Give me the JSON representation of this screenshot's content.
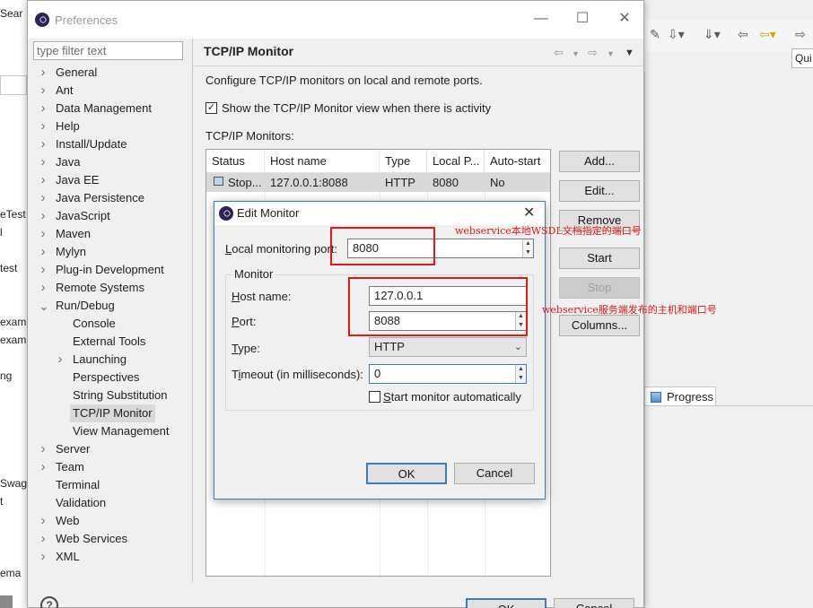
{
  "background": {
    "left_fragments": [
      "Sear",
      "eTest",
      "l",
      "test",
      "exam",
      "exam",
      "ng",
      "Swag",
      "t",
      "ema"
    ],
    "quick_access": "Qui",
    "progress_tab": "Progress"
  },
  "preferences": {
    "title": "Preferences",
    "filter_placeholder": "type filter text",
    "tree": [
      {
        "label": "General",
        "expandable": true
      },
      {
        "label": "Ant",
        "expandable": true
      },
      {
        "label": "Data Management",
        "expandable": true
      },
      {
        "label": "Help",
        "expandable": true
      },
      {
        "label": "Install/Update",
        "expandable": true
      },
      {
        "label": "Java",
        "expandable": true
      },
      {
        "label": "Java EE",
        "expandable": true
      },
      {
        "label": "Java Persistence",
        "expandable": true
      },
      {
        "label": "JavaScript",
        "expandable": true
      },
      {
        "label": "Maven",
        "expandable": true
      },
      {
        "label": "Mylyn",
        "expandable": true
      },
      {
        "label": "Plug-in Development",
        "expandable": true
      },
      {
        "label": "Remote Systems",
        "expandable": true
      },
      {
        "label": "Run/Debug",
        "expandable": true,
        "expanded": true
      },
      {
        "label": "Console",
        "child": true
      },
      {
        "label": "External Tools",
        "child": true
      },
      {
        "label": "Launching",
        "child": true,
        "expandable": true
      },
      {
        "label": "Perspectives",
        "child": true
      },
      {
        "label": "String Substitution",
        "child": true
      },
      {
        "label": "TCP/IP Monitor",
        "child": true,
        "selected": true
      },
      {
        "label": "View Management",
        "child": true
      },
      {
        "label": "Server",
        "expandable": true
      },
      {
        "label": "Team",
        "expandable": true
      },
      {
        "label": "Terminal"
      },
      {
        "label": "Validation"
      },
      {
        "label": "Web",
        "expandable": true
      },
      {
        "label": "Web Services",
        "expandable": true
      },
      {
        "label": "XML",
        "expandable": true
      }
    ],
    "page": {
      "title": "TCP/IP Monitor",
      "description": "Configure TCP/IP monitors on local and remote ports.",
      "show_view_checkbox": {
        "label": "Show the TCP/IP Monitor view when there is activity",
        "checked": true
      },
      "monitors_label": "TCP/IP Monitors:",
      "columns": [
        "Status",
        "Host name",
        "Type",
        "Local P...",
        "Auto-start"
      ],
      "rows": [
        {
          "status": "Stop...",
          "host": "127.0.0.1:8088",
          "type": "HTTP",
          "local_port": "8080",
          "auto_start": "No"
        }
      ],
      "buttons": {
        "add": "Add...",
        "edit": "Edit...",
        "remove": "Remove",
        "start": "Start",
        "stop": "Stop",
        "columns": "Columns..."
      }
    },
    "help_icon": "?",
    "ok": "OK",
    "cancel": "Cancel"
  },
  "edit_monitor": {
    "title": "Edit Monitor",
    "local_port_label": "Local monitoring port:",
    "local_port_value": "8080",
    "group_label": "Monitor",
    "host_label": "Host name:",
    "host_value": "127.0.0.1",
    "port_label": "Port:",
    "port_value": "8088",
    "type_label": "Type:",
    "type_value": "HTTP",
    "timeout_label": "Timeout (in milliseconds):",
    "timeout_value": "0",
    "auto_start_label": "Start monitor automatically",
    "auto_start_checked": false,
    "ok": "OK",
    "cancel": "Cancel"
  },
  "annotations": {
    "note1": "webservice本地WSDL文档指定的端口号",
    "note2": "webservice服务端发布的主机和端口号",
    "color": "#e11919"
  }
}
